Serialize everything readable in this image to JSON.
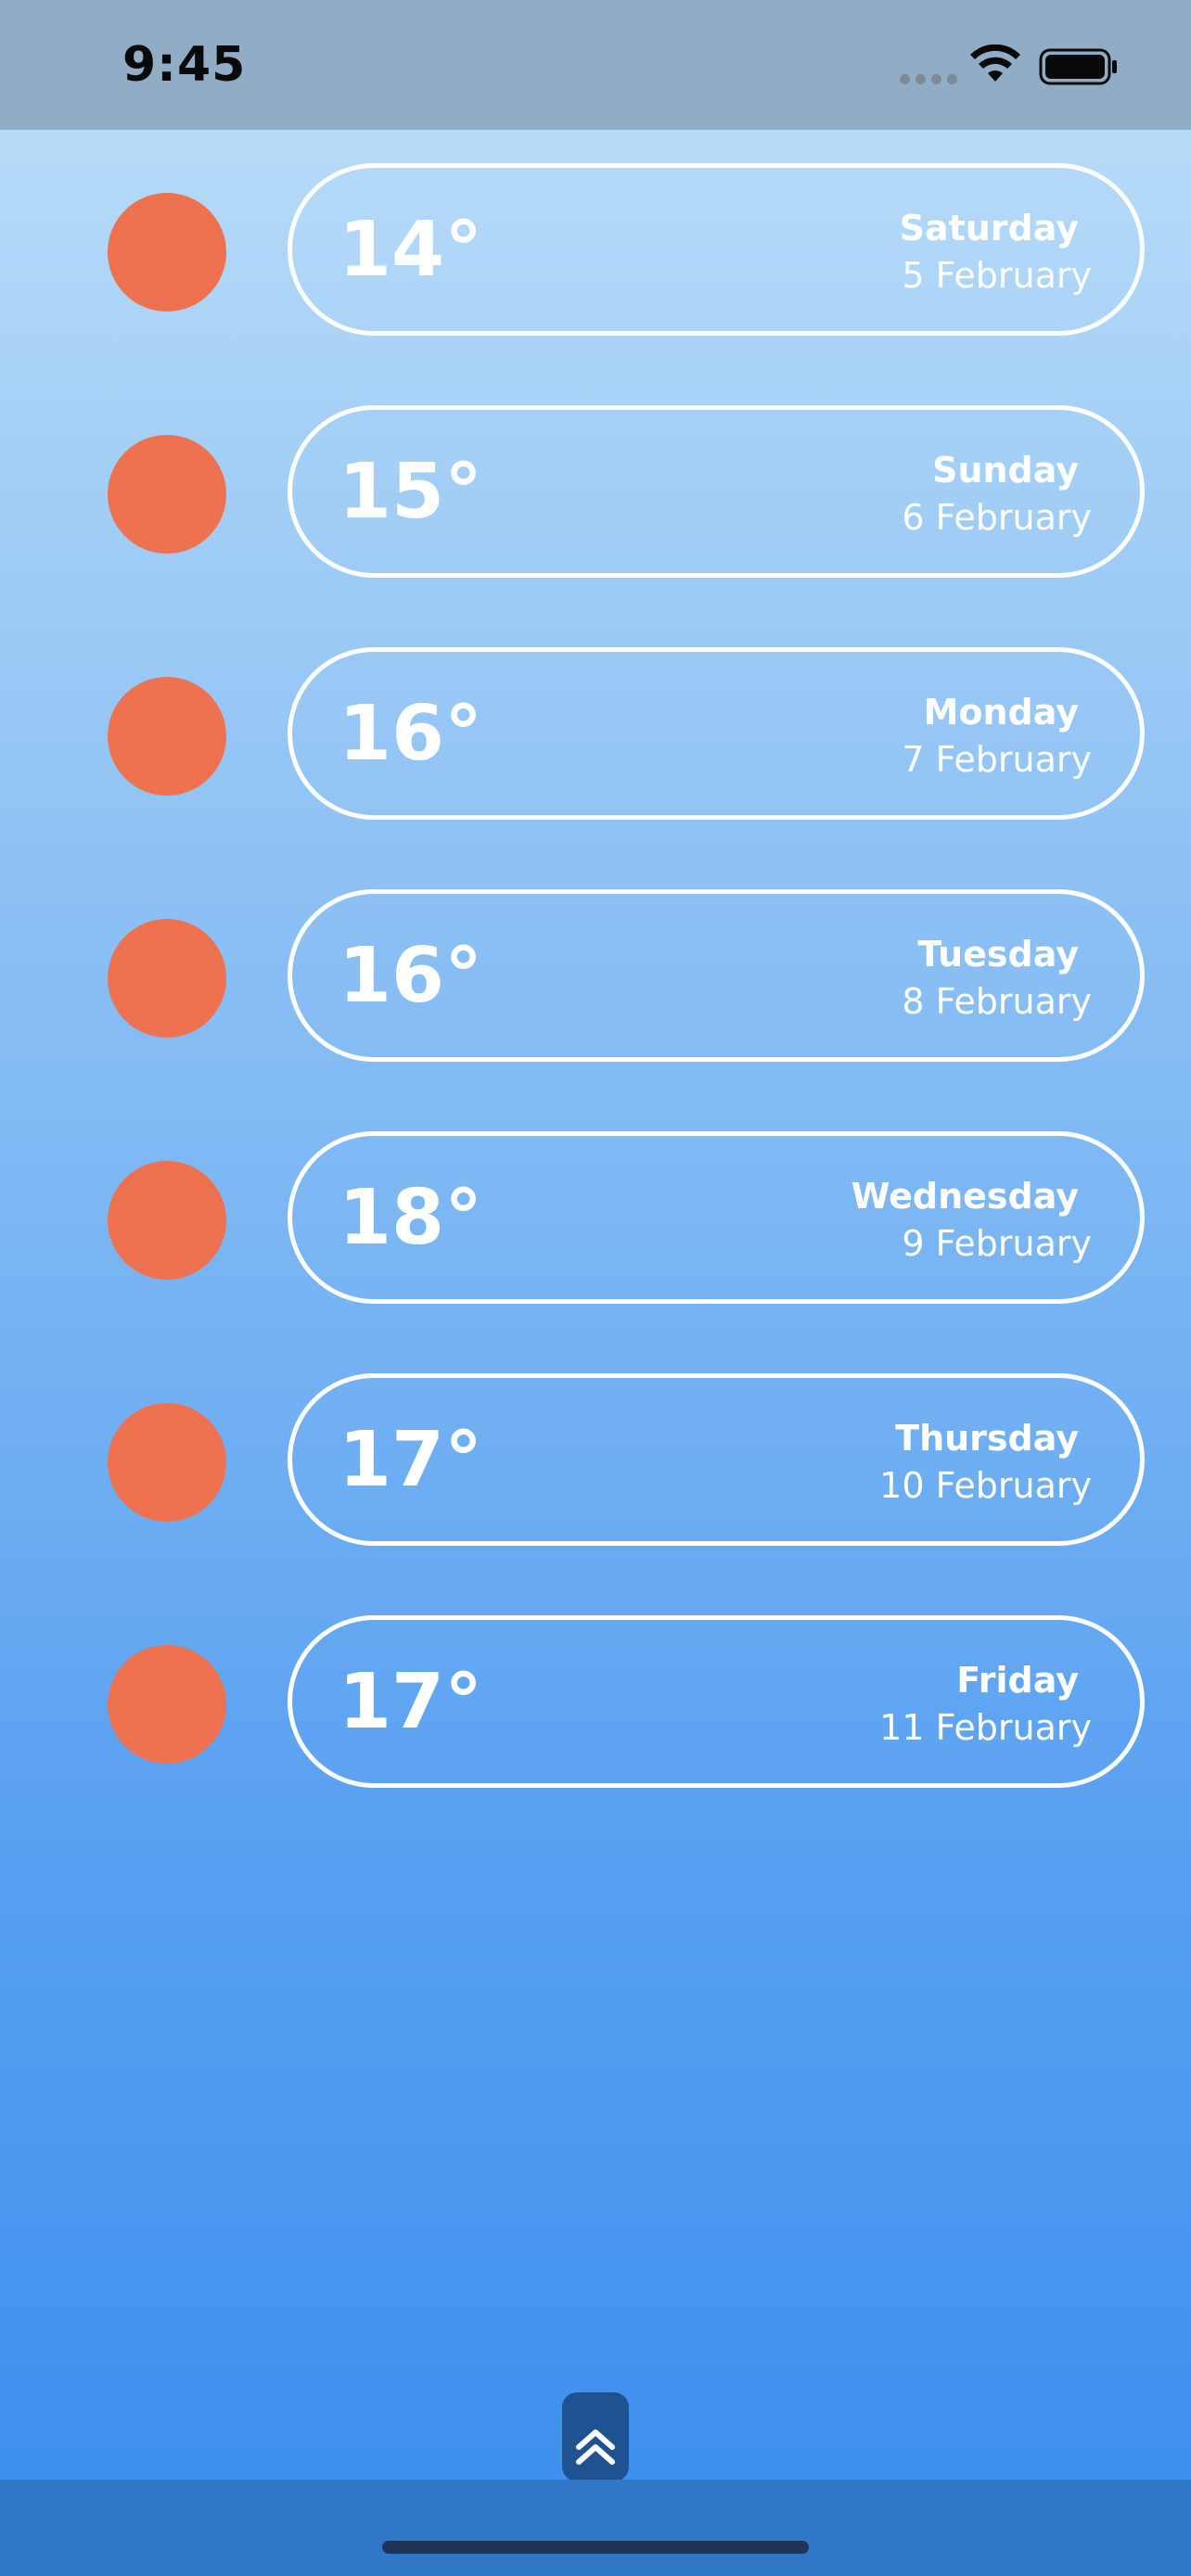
{
  "status_bar": {
    "time": "9:45",
    "icons": [
      "signal-dots-icon",
      "wifi-icon",
      "battery-icon"
    ]
  },
  "colors": {
    "weather_icon": "#ee7150",
    "pill_border": "#ffffff",
    "scroll_button": "#1f5290"
  },
  "forecast": [
    {
      "temp": "14°",
      "day": "Saturday",
      "date": "5 February",
      "icon": "sun-icon"
    },
    {
      "temp": "15°",
      "day": "Sunday",
      "date": "6 February",
      "icon": "sun-icon"
    },
    {
      "temp": "16°",
      "day": "Monday",
      "date": "7 February",
      "icon": "sun-icon"
    },
    {
      "temp": "16°",
      "day": "Tuesday",
      "date": "8 February",
      "icon": "sun-icon"
    },
    {
      "temp": "18°",
      "day": "Wednesday",
      "date": "9 February",
      "icon": "sun-icon"
    },
    {
      "temp": "17°",
      "day": "Thursday",
      "date": "10 February",
      "icon": "sun-icon"
    },
    {
      "temp": "17°",
      "day": "Friday",
      "date": "11 February",
      "icon": "sun-icon"
    }
  ],
  "scroll_button": {
    "icon": "double-chevron-up-icon"
  }
}
